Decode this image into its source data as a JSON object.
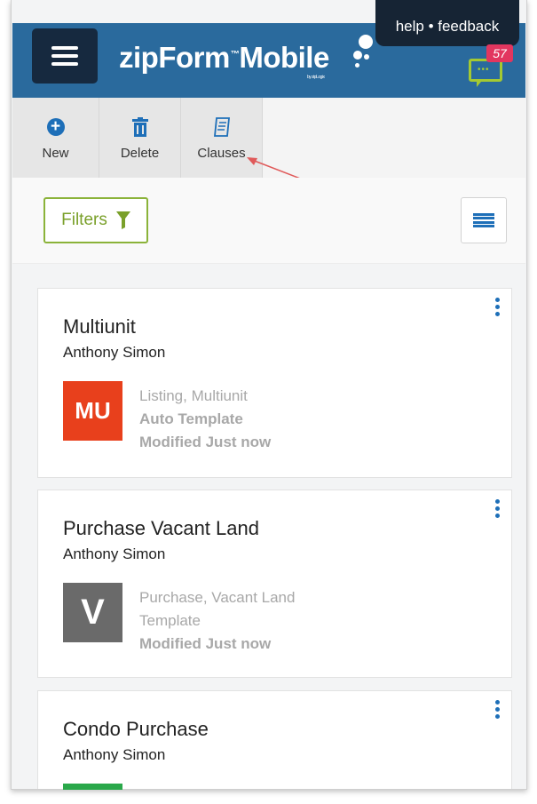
{
  "header": {
    "logo_text": "zipForm",
    "logo_text2": "Mobile",
    "logo_sub": "by zipLogix",
    "help_text": "help • feedback",
    "chat_badge": "57"
  },
  "toolbar": {
    "new_label": "New",
    "delete_label": "Delete",
    "clauses_label": "Clauses"
  },
  "filters": {
    "label": "Filters"
  },
  "colors": {
    "header_bg": "#2a6a9d",
    "accent": "#1e6fb8",
    "green": "#8bb33a",
    "badge": "#e2365f"
  },
  "cards": [
    {
      "title": "Multiunit",
      "owner": "Anthony Simon",
      "thumb": "MU",
      "thumb_color": "#e8401c",
      "line1": "Listing, Multiunit",
      "line2": "Auto Template",
      "line3": "Modified Just now"
    },
    {
      "title": "Purchase Vacant Land",
      "owner": "Anthony Simon",
      "thumb": "V",
      "thumb_color": "#6a6a6a",
      "line1": "Purchase, Vacant Land",
      "line2": "Template",
      "line3": "Modified Just now"
    },
    {
      "title": "Condo Purchase",
      "owner": "Anthony Simon",
      "thumb": "",
      "thumb_color": "#2aa84a",
      "line1": "",
      "line2": "",
      "line3": ""
    }
  ]
}
